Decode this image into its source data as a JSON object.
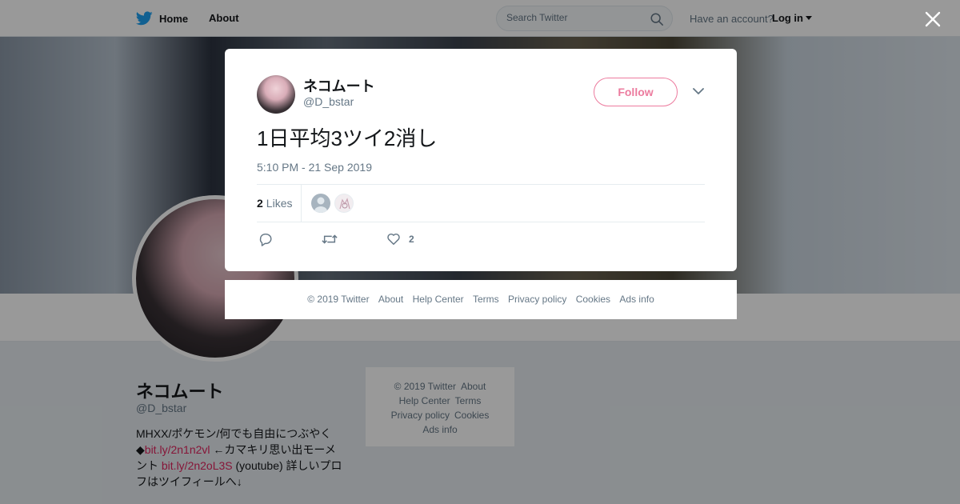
{
  "nav": {
    "home_label": "Home",
    "about_label": "About",
    "search_placeholder": "Search Twitter",
    "have_account": "Have an account?",
    "login_label": "Log in"
  },
  "profile": {
    "name": "ネコムート",
    "handle": "@D_bstar",
    "bio_text_1": "MHXX/ポケモン/何でも自由につぶやく◆",
    "bio_link_1": "bit.ly/2n1n2vl",
    "bio_text_2": " ←カマキリ思い出モーメント ",
    "bio_link_2": "bit.ly/2n2oL3S",
    "bio_text_3": " (youtube) 詳しいプロフはツイフィールへ↓"
  },
  "side_footer": {
    "copyright": "© 2019 Twitter",
    "about": "About",
    "help": "Help Center",
    "terms": "Terms",
    "privacy": "Privacy policy",
    "cookies": "Cookies",
    "ads": "Ads info"
  },
  "tweet": {
    "author_name": "ネコムート",
    "author_handle": "@D_bstar",
    "follow_label": "Follow",
    "text": "1日平均3ツイ2消し",
    "timestamp": "5:10 PM - 21 Sep 2019",
    "likes_count": "2",
    "likes_label": "Likes",
    "like_action_count": "2"
  },
  "modal_footer": {
    "copyright": "© 2019 Twitter",
    "about": "About",
    "help": "Help Center",
    "terms": "Terms",
    "privacy": "Privacy policy",
    "cookies": "Cookies",
    "ads": "Ads info"
  },
  "colors": {
    "twitter_blue": "#1da1f2",
    "like_accent": "#e0245e",
    "muted": "#657786"
  }
}
